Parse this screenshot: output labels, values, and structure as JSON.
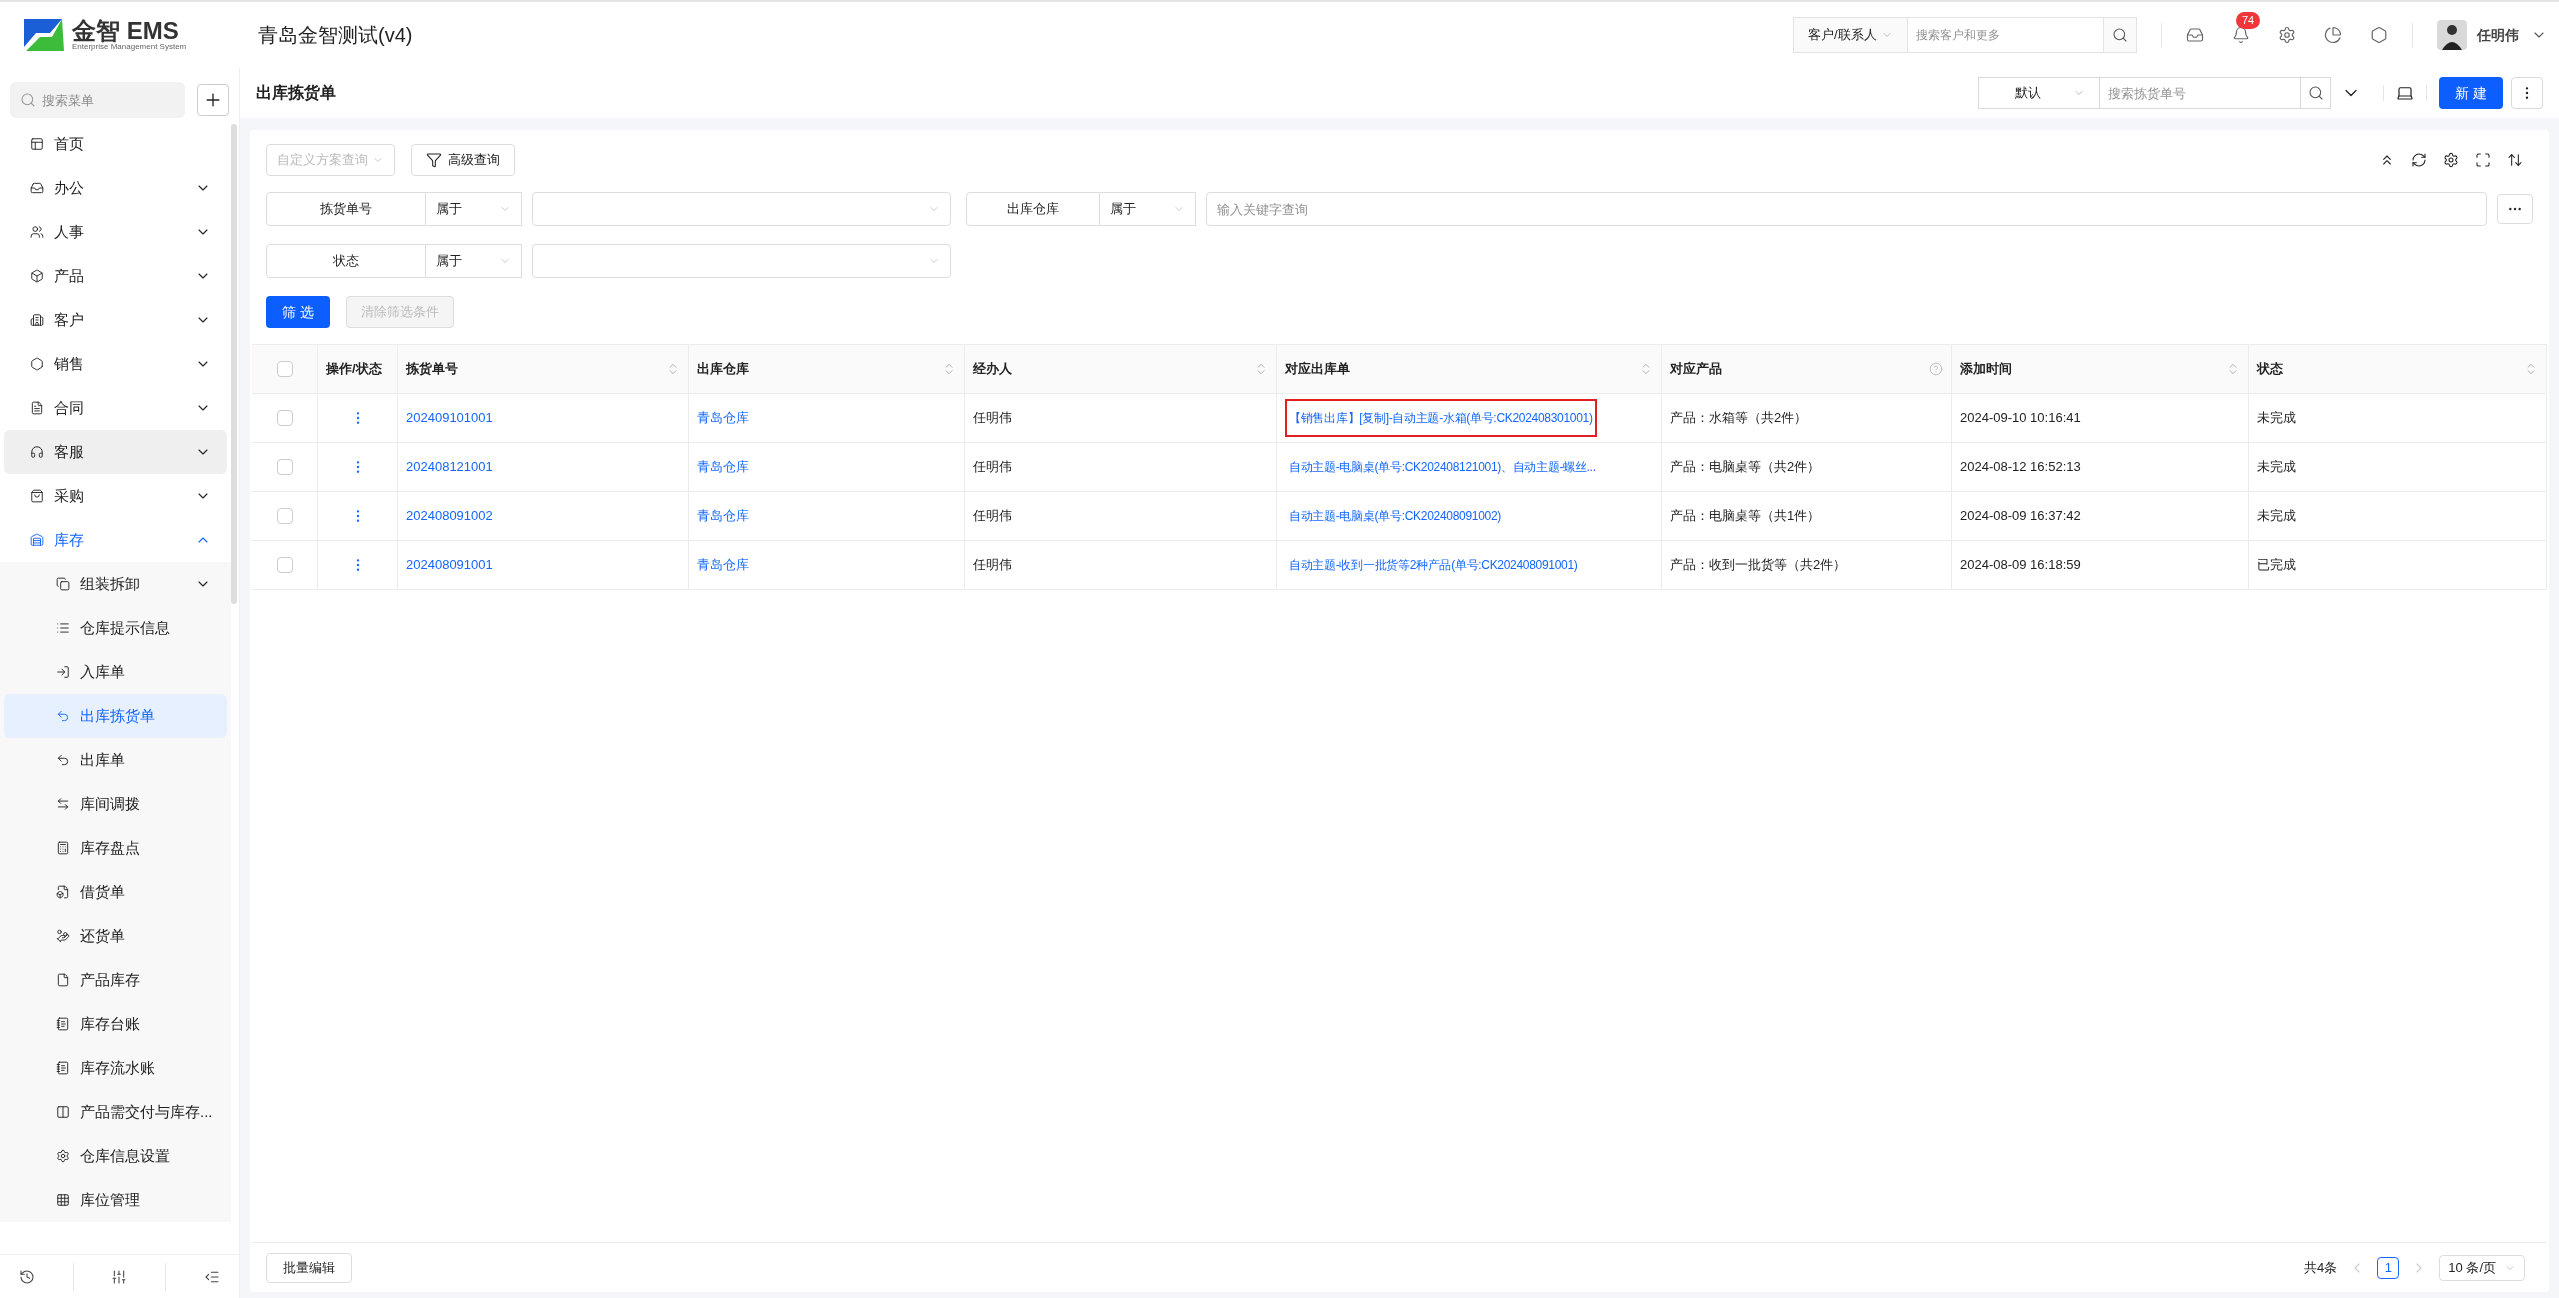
{
  "app": {
    "logo_title": "金智 EMS",
    "logo_subtitle": "Enterprise Management System",
    "company": "青岛金智测试(v4)"
  },
  "header": {
    "search_scope": "客户/联系人",
    "search_placeholder": "搜索客户和更多",
    "notification_count": "74",
    "user_name": "任明伟"
  },
  "sidebar": {
    "search_placeholder": "搜索菜单",
    "items": [
      {
        "label": "首页",
        "selected": false,
        "hovered": false
      },
      {
        "label": "办公",
        "selected": false,
        "hovered": false,
        "expanded": false
      },
      {
        "label": "人事",
        "selected": false,
        "hovered": false,
        "expanded": false
      },
      {
        "label": "产品",
        "selected": false,
        "hovered": false,
        "expanded": false
      },
      {
        "label": "客户",
        "selected": false,
        "hovered": false,
        "expanded": false
      },
      {
        "label": "销售",
        "selected": false,
        "hovered": false,
        "expanded": false
      },
      {
        "label": "合同",
        "selected": false,
        "hovered": false,
        "expanded": false
      },
      {
        "label": "客服",
        "selected": false,
        "hovered": true,
        "expanded": false
      },
      {
        "label": "采购",
        "selected": false,
        "hovered": false,
        "expanded": false
      },
      {
        "label": "库存",
        "selected": false,
        "hovered": false,
        "expanded": true,
        "children": [
          {
            "label": "组装拆卸",
            "selected": false,
            "expanded": false
          },
          {
            "label": "仓库提示信息",
            "selected": false
          },
          {
            "label": "入库单",
            "selected": false
          },
          {
            "label": "出库拣货单",
            "selected": true
          },
          {
            "label": "出库单",
            "selected": false
          },
          {
            "label": "库间调拨",
            "selected": false
          },
          {
            "label": "库存盘点",
            "selected": false
          },
          {
            "label": "借货单",
            "selected": false
          },
          {
            "label": "还货单",
            "selected": false
          },
          {
            "label": "产品库存",
            "selected": false
          },
          {
            "label": "库存台账",
            "selected": false
          },
          {
            "label": "库存流水账",
            "selected": false
          },
          {
            "label": "产品需交付与库存...",
            "selected": false
          },
          {
            "label": "仓库信息设置",
            "selected": false
          },
          {
            "label": "库位管理",
            "selected": false
          }
        ]
      }
    ]
  },
  "page": {
    "title": "出库拣货单",
    "view_select": "默认",
    "search_placeholder": "搜索拣货单号",
    "new_button": "新 建"
  },
  "query": {
    "scheme_placeholder": "自定义方案查询",
    "advanced_button": "高级查询",
    "filters": [
      {
        "field": "拣货单号",
        "operator": "属于",
        "kind": "select"
      },
      {
        "field": "出库仓库",
        "operator": "属于",
        "kind": "text",
        "placeholder": "输入关键字查询"
      },
      {
        "field": "状态",
        "operator": "属于",
        "kind": "select"
      }
    ],
    "apply_button": "筛 选",
    "clear_button": "清除筛选条件",
    "clear_disabled": true
  },
  "table": {
    "select_all_checked": false,
    "columns": [
      {
        "label": "操作/状态",
        "sortable": false,
        "help": false
      },
      {
        "label": "拣货单号",
        "sortable": true,
        "help": false
      },
      {
        "label": "出库仓库",
        "sortable": true,
        "help": false
      },
      {
        "label": "经办人",
        "sortable": true,
        "help": false
      },
      {
        "label": "对应出库单",
        "sortable": true,
        "help": false
      },
      {
        "label": "对应产品",
        "sortable": false,
        "help": true
      },
      {
        "label": "添加时间",
        "sortable": true,
        "help": false
      },
      {
        "label": "状态",
        "sortable": true,
        "help": false
      }
    ],
    "rows": [
      {
        "checked": false,
        "pick_no": "202409101001",
        "warehouse": "青岛仓库",
        "handler": "任明伟",
        "outbound": "【销售出库】[复制]-自动主题-水箱(单号:CK202408301001)",
        "highlighted": true,
        "product": "产品：水箱等（共2件）",
        "added": "2024-09-10 10:16:41",
        "status": "未完成"
      },
      {
        "checked": false,
        "pick_no": "202408121001",
        "warehouse": "青岛仓库",
        "handler": "任明伟",
        "outbound": "自动主题-电脑桌(单号:CK202408121001)、自动主题-螺丝...",
        "highlighted": false,
        "product": "产品：电脑桌等（共2件）",
        "added": "2024-08-12 16:52:13",
        "status": "未完成"
      },
      {
        "checked": false,
        "pick_no": "202408091002",
        "warehouse": "青岛仓库",
        "handler": "任明伟",
        "outbound": "自动主题-电脑桌(单号:CK202408091002)",
        "highlighted": false,
        "product": "产品：电脑桌等（共1件）",
        "added": "2024-08-09 16:37:42",
        "status": "未完成"
      },
      {
        "checked": false,
        "pick_no": "202408091001",
        "warehouse": "青岛仓库",
        "handler": "任明伟",
        "outbound": "自动主题-收到一批货等2种产品(单号:CK202408091001)",
        "highlighted": false,
        "product": "产品：收到一批货等（共2件）",
        "added": "2024-08-09 16:18:59",
        "status": "已完成"
      }
    ]
  },
  "footer": {
    "batch_button": "批量编辑",
    "total": "共4条",
    "current_page": "1",
    "page_size": "10 条/页"
  }
}
